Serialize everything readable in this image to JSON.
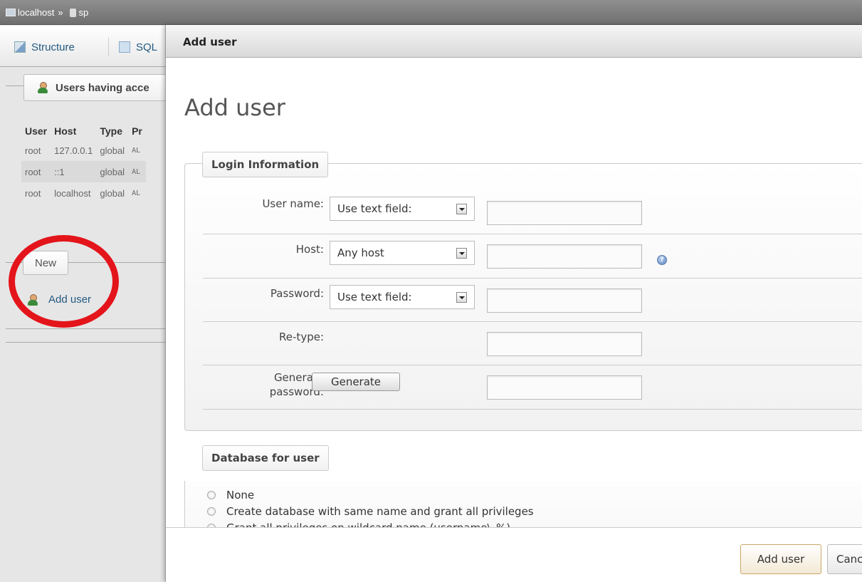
{
  "breadcrumb": {
    "server": "localhost",
    "separator": "»",
    "database": "sp"
  },
  "background_tabs": [
    {
      "label": "Structure"
    },
    {
      "label": "SQL"
    }
  ],
  "users_panel": {
    "legend": "Users having acce",
    "columns": [
      "User",
      "Host",
      "Type",
      "Pr"
    ],
    "rows": [
      {
        "user": "root",
        "host": "127.0.0.1",
        "type": "global",
        "priv": "AL"
      },
      {
        "user": "root",
        "host": "::1",
        "type": "global",
        "priv": "AL"
      },
      {
        "user": "root",
        "host": "localhost",
        "type": "global",
        "priv": "AL"
      }
    ]
  },
  "new_section": {
    "legend": "New",
    "add_user_link": "Add user"
  },
  "dialog": {
    "title": "Add user",
    "heading": "Add user",
    "login_info": {
      "legend": "Login Information",
      "user_name": {
        "label": "User name:",
        "select": "Use text field:",
        "value": ""
      },
      "host": {
        "label": "Host:",
        "select": "Any host",
        "value": "",
        "help_icon": "help-icon"
      },
      "password": {
        "label": "Password:",
        "select": "Use text field:",
        "value": ""
      },
      "retype": {
        "label": "Re-type:",
        "value": ""
      },
      "generate": {
        "label_line1": "Generate",
        "label_line2": "password:",
        "button": "Generate",
        "value": ""
      }
    },
    "database_for_user": {
      "legend": "Database for user",
      "options": [
        "None",
        "Create database with same name and grant all privileges",
        "Grant all privileges on wildcard name (username\\_%)"
      ]
    },
    "footer": {
      "add_button": "Add user",
      "cancel_button": "Cancel"
    }
  },
  "colors": {
    "annotation_circle": "#e4141b",
    "link": "#235a81"
  }
}
